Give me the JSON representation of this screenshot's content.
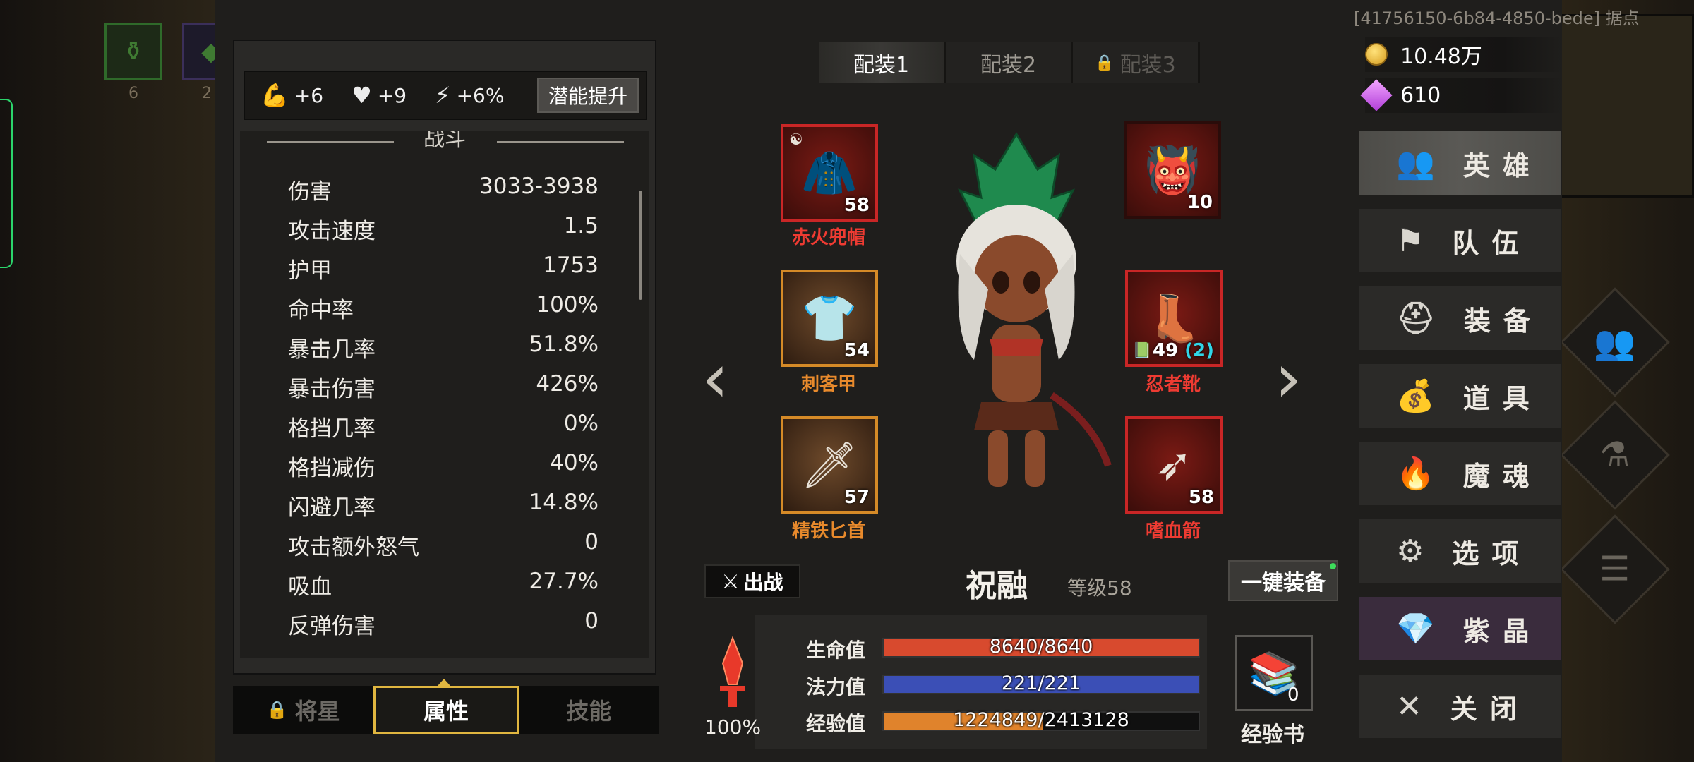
{
  "watermark": "[41756150-6b84-4850-bede] 据点",
  "background": {
    "left_slots": [
      {
        "icon": "potion-icon",
        "count": "6"
      },
      {
        "icon": "item-icon",
        "count": "2"
      }
    ]
  },
  "potential": {
    "strength": "+6",
    "health": "+9",
    "energy": "+6%",
    "upgrade_label": "潜能提升"
  },
  "stats": {
    "section_title": "战斗",
    "rows": [
      {
        "label": "伤害",
        "value": "3033-3938"
      },
      {
        "label": "攻击速度",
        "value": "1.5"
      },
      {
        "label": "护甲",
        "value": "1753"
      },
      {
        "label": "命中率",
        "value": "100%"
      },
      {
        "label": "暴击几率",
        "value": "51.8%"
      },
      {
        "label": "暴击伤害",
        "value": "426%"
      },
      {
        "label": "格挡几率",
        "value": "0%"
      },
      {
        "label": "格挡减伤",
        "value": "40%"
      },
      {
        "label": "闪避几率",
        "value": "14.8%"
      },
      {
        "label": "攻击额外怒气",
        "value": "0"
      },
      {
        "label": "吸血",
        "value": "27.7%"
      },
      {
        "label": "反弹伤害",
        "value": "0"
      }
    ]
  },
  "bottom_tabs": [
    {
      "label": "将星",
      "locked": true
    },
    {
      "label": "属性",
      "active": true
    },
    {
      "label": "技能"
    }
  ],
  "loadouts": [
    {
      "label": "配装1",
      "active": true
    },
    {
      "label": "配装2"
    },
    {
      "label": "配装3",
      "locked": true
    }
  ],
  "equipment": {
    "helmet": {
      "name": "赤火兜帽",
      "level": "58"
    },
    "armor": {
      "name": "刺客甲",
      "level": "54"
    },
    "dagger": {
      "name": "精铁匕首",
      "level": "57"
    },
    "accessory": {
      "name": "",
      "level": "10"
    },
    "boots": {
      "name": "忍者靴",
      "level": "49",
      "bonus": "(2)"
    },
    "arrow": {
      "name": "嗜血箭",
      "level": "58"
    }
  },
  "hero": {
    "fight_label": "出战",
    "name": "祝融",
    "level": "等级58",
    "equip_all_label": "一键装备",
    "rage_percent": "100%",
    "hp_label": "生命值",
    "hp": "8640/8640",
    "hp_ratio": 1.0,
    "mp_label": "法力值",
    "mp": "221/221",
    "mp_ratio": 1.0,
    "exp_label": "经验值",
    "exp": "1224849/2413128",
    "exp_ratio": 0.5076,
    "exp_book_count": "0",
    "exp_book_label": "经验书"
  },
  "currency": {
    "gold": "10.48万",
    "crystal": "610"
  },
  "menu": [
    {
      "label": "英雄",
      "icon": "hero-icon",
      "active": true
    },
    {
      "label": "队伍",
      "icon": "flag-icon"
    },
    {
      "label": "装备",
      "icon": "helmet-icon"
    },
    {
      "label": "道具",
      "icon": "bag-icon"
    },
    {
      "label": "魔魂",
      "icon": "flame-icon"
    },
    {
      "label": "选项",
      "icon": "gear-icon"
    },
    {
      "label": "紫晶",
      "icon": "crystal-icon"
    },
    {
      "label": "关闭",
      "icon": "close-icon"
    }
  ],
  "colors": {
    "hp": "#d84a2e",
    "mp": "#3b4fb6",
    "exp": "#e0832c",
    "tab_highlight": "#e0b640",
    "epic_border": "#c92626",
    "rare_border": "#d58a27"
  }
}
